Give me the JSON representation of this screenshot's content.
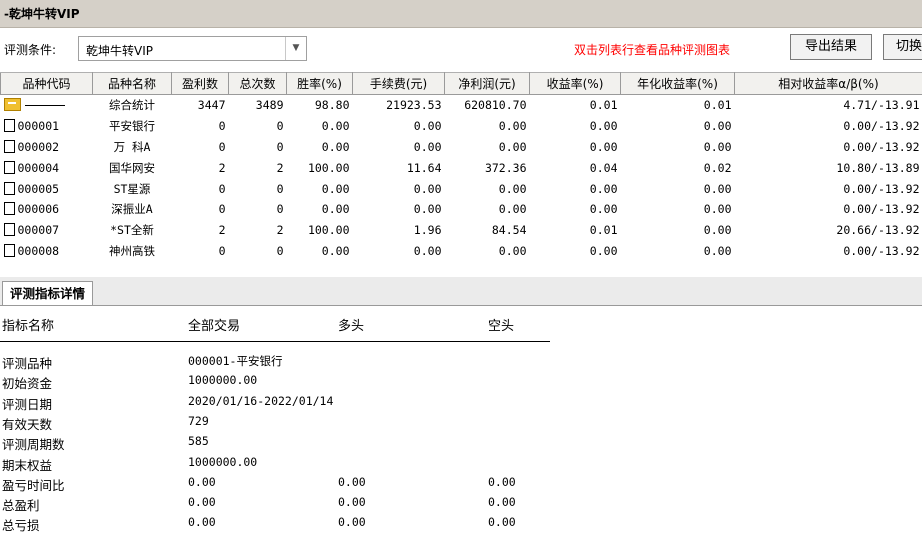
{
  "title": "-乾坤牛转VIP",
  "condition": {
    "label": "评测条件:",
    "value": "乾坤牛转VIP"
  },
  "hint": "双击列表行查看品种评测图表",
  "buttons": {
    "export": "导出结果",
    "switch": "切换"
  },
  "table": {
    "headers": [
      "品种代码",
      "品种名称",
      "盈利数",
      "总次数",
      "胜率(%)",
      "手续费(元)",
      "净利润(元)",
      "收益率(%)",
      "年化收益率(%)",
      "相对收益率α/β(%)"
    ],
    "rows": [
      {
        "code": "",
        "name": "综合统计",
        "profit": "3447",
        "total": "3489",
        "win": "98.80",
        "fee": "21923.53",
        "net": "620810.70",
        "ret": "0.01",
        "annual": "0.01",
        "relative": "4.71/-13.91",
        "summary": true
      },
      {
        "code": "000001",
        "name": "平安银行",
        "profit": "0",
        "total": "0",
        "win": "0.00",
        "fee": "0.00",
        "net": "0.00",
        "ret": "0.00",
        "annual": "0.00",
        "relative": "0.00/-13.92"
      },
      {
        "code": "000002",
        "name": "万 科A",
        "profit": "0",
        "total": "0",
        "win": "0.00",
        "fee": "0.00",
        "net": "0.00",
        "ret": "0.00",
        "annual": "0.00",
        "relative": "0.00/-13.92"
      },
      {
        "code": "000004",
        "name": "国华网安",
        "profit": "2",
        "total": "2",
        "win": "100.00",
        "fee": "11.64",
        "net": "372.36",
        "ret": "0.04",
        "annual": "0.02",
        "relative": "10.80/-13.89"
      },
      {
        "code": "000005",
        "name": "ST星源",
        "profit": "0",
        "total": "0",
        "win": "0.00",
        "fee": "0.00",
        "net": "0.00",
        "ret": "0.00",
        "annual": "0.00",
        "relative": "0.00/-13.92"
      },
      {
        "code": "000006",
        "name": "深振业A",
        "profit": "0",
        "total": "0",
        "win": "0.00",
        "fee": "0.00",
        "net": "0.00",
        "ret": "0.00",
        "annual": "0.00",
        "relative": "0.00/-13.92"
      },
      {
        "code": "000007",
        "name": "*ST全新",
        "profit": "2",
        "total": "2",
        "win": "100.00",
        "fee": "1.96",
        "net": "84.54",
        "ret": "0.01",
        "annual": "0.00",
        "relative": "20.66/-13.92"
      },
      {
        "code": "000008",
        "name": "神州高铁",
        "profit": "0",
        "total": "0",
        "win": "0.00",
        "fee": "0.00",
        "net": "0.00",
        "ret": "0.00",
        "annual": "0.00",
        "relative": "0.00/-13.92"
      }
    ]
  },
  "detail": {
    "tab": "评测指标详情",
    "headers": {
      "name": "指标名称",
      "all": "全部交易",
      "long": "多头",
      "short": "空头"
    },
    "rows": [
      {
        "label": "评测品种",
        "all": "000001-平安银行",
        "long": "",
        "short": ""
      },
      {
        "label": "初始资金",
        "all": "1000000.00",
        "long": "",
        "short": ""
      },
      {
        "label": "评测日期",
        "all": "2020/01/16-2022/01/14",
        "long": "",
        "short": ""
      },
      {
        "label": "有效天数",
        "all": "729",
        "long": "",
        "short": ""
      },
      {
        "label": "评测周期数",
        "all": "585",
        "long": "",
        "short": ""
      },
      {
        "label": "期末权益",
        "all": "1000000.00",
        "long": "",
        "short": ""
      },
      {
        "label": "盈亏时间比",
        "all": "0.00",
        "long": "0.00",
        "short": "0.00"
      },
      {
        "label": "总盈利",
        "all": "0.00",
        "long": "0.00",
        "short": "0.00"
      },
      {
        "label": "总亏损",
        "all": "0.00",
        "long": "0.00",
        "short": "0.00"
      }
    ]
  }
}
